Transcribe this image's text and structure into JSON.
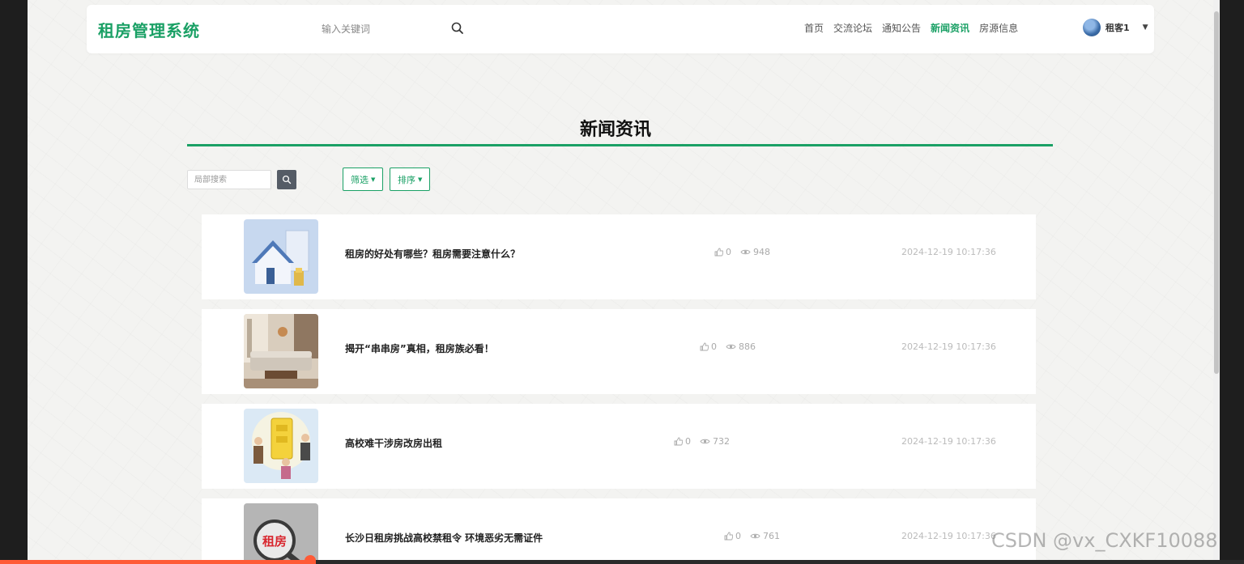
{
  "header": {
    "logo": "租房管理系统",
    "search_placeholder": "输入关键词",
    "nav": [
      "首页",
      "交流论坛",
      "通知公告",
      "新闻资讯",
      "房源信息"
    ],
    "active_nav": "新闻资讯",
    "user_name": "租客1"
  },
  "page": {
    "title": "新闻资讯",
    "local_search_placeholder": "局部搜索",
    "filter_label": "筛选",
    "sort_label": "排序"
  },
  "news": [
    {
      "title": "租房的好处有哪些？租房需要注意什么？",
      "likes": "0",
      "views": "948",
      "date": "2024-12-19 10:17:36"
    },
    {
      "title": "揭开“串串房”真相，租房族必看！",
      "likes": "0",
      "views": "886",
      "date": "2024-12-19 10:17:36"
    },
    {
      "title": "高校难干涉房改房出租",
      "likes": "0",
      "views": "732",
      "date": "2024-12-19 10:17:36"
    },
    {
      "title": "长沙日租房挑战高校禁租令 环境恶劣无需证件",
      "likes": "0",
      "views": "761",
      "date": "2024-12-19 10:17:36"
    }
  ],
  "thumb_text": "租房",
  "watermark": "CSDN @vx_CXKF10088",
  "colors": {
    "accent": "#1aa065",
    "progress": "#ff5a36"
  }
}
